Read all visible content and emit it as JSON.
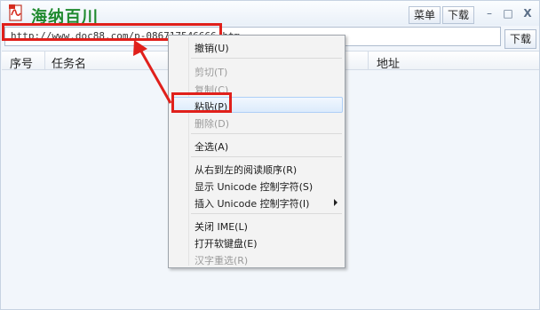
{
  "titlebar": {
    "app_title": "海纳百川",
    "menu_label": "菜单",
    "download_label": "下载",
    "minimize_symbol": "–",
    "maximize_symbol": "□",
    "close_symbol": "X"
  },
  "url_bar": {
    "value": "http://www.doc88.com/p-086717546666.htm",
    "download_label": "下载"
  },
  "list": {
    "columns": [
      "序号",
      "任务名",
      "地址"
    ]
  },
  "context_menu": {
    "items": [
      {
        "label": "撤销(U)",
        "enabled": true
      },
      {
        "label": "剪切(T)",
        "enabled": false
      },
      {
        "label": "复制(C)",
        "enabled": false
      },
      {
        "label": "粘贴(P)",
        "enabled": true,
        "highlighted": true
      },
      {
        "label": "删除(D)",
        "enabled": false
      },
      {
        "label": "全选(A)",
        "enabled": true
      },
      {
        "label": "从右到左的阅读顺序(R)",
        "enabled": true
      },
      {
        "label": "显示 Unicode 控制字符(S)",
        "enabled": true
      },
      {
        "label": "插入 Unicode 控制字符(I)",
        "enabled": true,
        "submenu": true
      },
      {
        "label": "关闭 IME(L)",
        "enabled": true
      },
      {
        "label": "打开软键盘(E)",
        "enabled": true
      },
      {
        "label": "汉字重选(R)",
        "enabled": false
      }
    ]
  },
  "colors": {
    "annotation_red": "#e0201b",
    "title_green": "#1f8a2e"
  },
  "icons": {
    "app_logo": "pdf-document-icon",
    "submenu": "chevron-right-icon"
  }
}
